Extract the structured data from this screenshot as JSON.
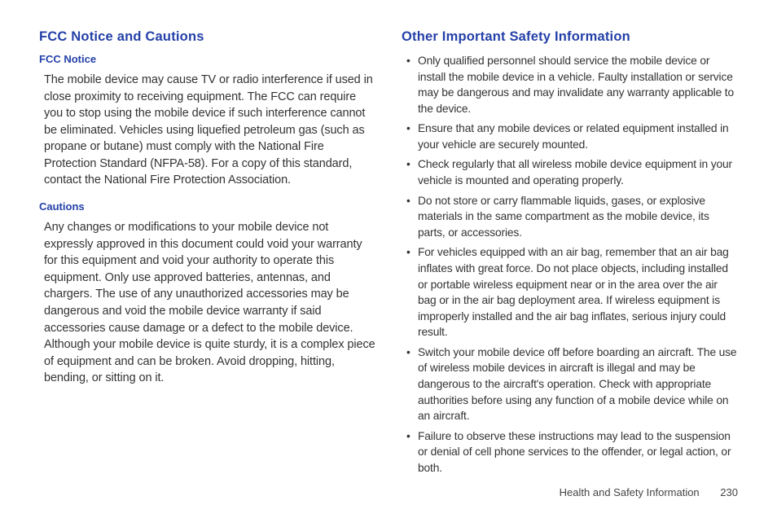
{
  "left": {
    "heading": "FCC Notice and Cautions",
    "sub1": "FCC Notice",
    "p1": "The mobile device may cause TV or radio interference if used in close proximity to receiving equipment. The FCC can require you to stop using the mobile device if such interference cannot be eliminated. Vehicles using liquefied petroleum gas (such as propane or butane) must comply with the National Fire Protection Standard (NFPA-58). For a copy of this standard, contact the National Fire Protection Association.",
    "sub2": "Cautions",
    "p2": "Any changes or modifications to your mobile device not expressly approved in this document could void your warranty for this equipment and void your authority to operate this equipment. Only use approved batteries, antennas, and chargers. The use of any unauthorized accessories may be dangerous and void the mobile device warranty if said accessories cause damage or a defect to the mobile device. Although your mobile device is quite sturdy, it is a complex piece of equipment and can be broken. Avoid dropping, hitting, bending, or sitting on it."
  },
  "right": {
    "heading": "Other Important Safety Information",
    "bullets": [
      "Only qualified personnel should service the mobile device or install the mobile device in a vehicle. Faulty installation or service may be dangerous and may invalidate any warranty applicable to the device.",
      "Ensure that any mobile devices or related equipment installed in your vehicle are securely mounted.",
      "Check regularly that all wireless mobile device equipment in your vehicle is mounted and operating properly.",
      "Do not store or carry flammable liquids, gases, or explosive materials in the same compartment as the mobile device, its parts, or accessories.",
      "For vehicles equipped with an air bag, remember that an air bag inflates with great force. Do not place objects, including installed or portable wireless equipment near or in the area over the air bag or in the air bag deployment area. If wireless equipment is improperly installed and the air bag inflates, serious injury could result.",
      "Switch your mobile device off before boarding an aircraft. The use of wireless mobile devices in aircraft is illegal and may be dangerous to the aircraft's operation. Check with appropriate authorities before using any function of a mobile device while on an aircraft.",
      "Failure to observe these instructions may lead to the suspension or denial of cell phone services to the offender, or legal action, or both."
    ]
  },
  "footer": {
    "section": "Health and Safety Information",
    "page": "230"
  }
}
